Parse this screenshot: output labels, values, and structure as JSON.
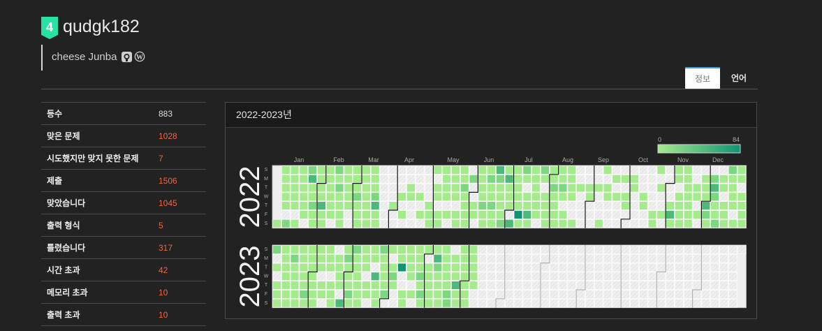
{
  "profile": {
    "tier_number": "4",
    "tier_color": "#27e2a4",
    "username": "qudgk182",
    "bio": "cheese Junba",
    "bio_icons": [
      "github-icon",
      "wordpress-icon"
    ]
  },
  "tabs": [
    {
      "label": "정보",
      "active": true
    },
    {
      "label": "언어",
      "active": false
    }
  ],
  "stats": [
    {
      "label": "등수",
      "value": "883",
      "accent": false
    },
    {
      "label": "맞은 문제",
      "value": "1028",
      "accent": true
    },
    {
      "label": "시도했지만 맞지 못한 문제",
      "value": "7",
      "accent": true
    },
    {
      "label": "제출",
      "value": "1506",
      "accent": true
    },
    {
      "label": "맞았습니다",
      "value": "1045",
      "accent": true
    },
    {
      "label": "출력 형식",
      "value": "5",
      "accent": true
    },
    {
      "label": "틀렸습니다",
      "value": "317",
      "accent": true
    },
    {
      "label": "시간 초과",
      "value": "42",
      "accent": true
    },
    {
      "label": "메모리 초과",
      "value": "10",
      "accent": true
    },
    {
      "label": "출력 초과",
      "value": "10",
      "accent": true
    }
  ],
  "calendar": {
    "title": "2022-2023년",
    "legend_min": "0",
    "legend_max": "84",
    "months": [
      "Jan",
      "Feb",
      "Mar",
      "Apr",
      "May",
      "Jun",
      "Jul",
      "Aug",
      "Sep",
      "Oct",
      "Nov",
      "Dec"
    ],
    "weekdays": [
      "S",
      "M",
      "T",
      "W",
      "T",
      "F",
      "S"
    ],
    "years": [
      "2022",
      "2023"
    ],
    "colors": {
      "empty": "#f0f0f0",
      "low": "#a6ea8e",
      "mid": "#7fd682",
      "high": "#4cb87a",
      "max": "#129473"
    }
  }
}
